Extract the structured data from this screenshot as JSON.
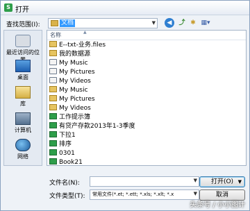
{
  "window": {
    "title": "打开"
  },
  "lookin": {
    "label": "查找范围(I):",
    "value": "文档"
  },
  "places": [
    {
      "label": "最近访问的位置",
      "icon": "recent-places-icon"
    },
    {
      "label": "桌面",
      "icon": "desktop-icon"
    },
    {
      "label": "库",
      "icon": "libraries-icon"
    },
    {
      "label": "计算机",
      "icon": "computer-icon"
    },
    {
      "label": "网络",
      "icon": "network-icon"
    }
  ],
  "filelist": {
    "column_name": "名称",
    "items": [
      {
        "name": "E--txt-业务.files",
        "icon": "folder-icon"
      },
      {
        "name": "我的数据源",
        "icon": "folder-icon"
      },
      {
        "name": "My Music",
        "icon": "shortcut-folder-icon"
      },
      {
        "name": "My Pictures",
        "icon": "shortcut-folder-icon"
      },
      {
        "name": "My Videos",
        "icon": "shortcut-folder-icon"
      },
      {
        "name": "My Music",
        "icon": "folder-icon"
      },
      {
        "name": "My Pictures",
        "icon": "folder-icon"
      },
      {
        "name": "My Videos",
        "icon": "folder-icon"
      },
      {
        "name": "工作提示簿",
        "icon": "spreadsheet-icon"
      },
      {
        "name": "有贷产存款2013年1-3季度",
        "icon": "spreadsheet-icon"
      },
      {
        "name": "下拉1",
        "icon": "spreadsheet-icon"
      },
      {
        "name": "排序",
        "icon": "spreadsheet-icon"
      },
      {
        "name": "0301",
        "icon": "spreadsheet-icon"
      },
      {
        "name": "Book21",
        "icon": "spreadsheet-icon"
      }
    ]
  },
  "footer": {
    "filename_label": "文件名(N):",
    "filename_value": "",
    "filetype_label": "文件类型(T):",
    "filetype_value": "常用文件(*.et; *.ett; *.xls; *.xlt; *.x",
    "open_button": "打开(O)",
    "cancel_button": "取消"
  },
  "watermark": "头条号 / 小小图计"
}
